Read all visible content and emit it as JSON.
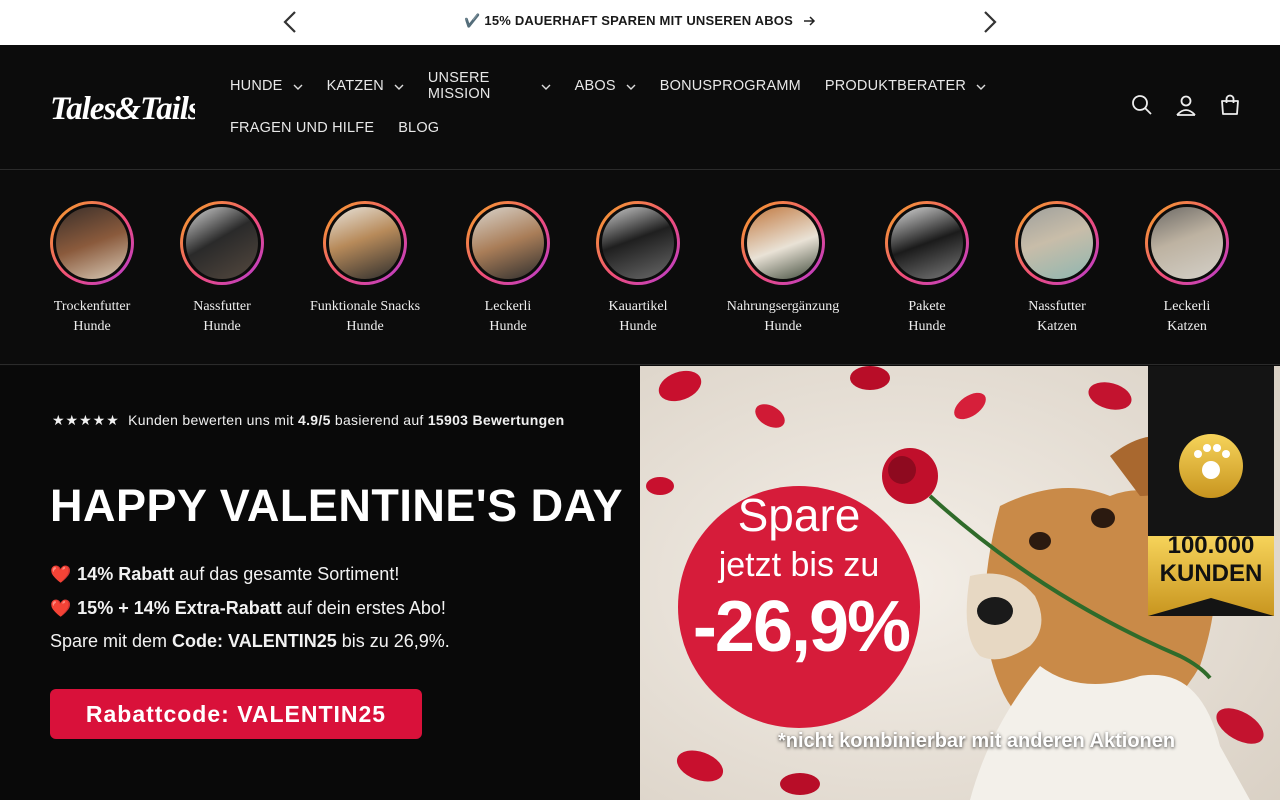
{
  "announcement": {
    "text": "✔️ 15% DAUERHAFT SPAREN MIT UNSEREN ABOS",
    "arrow": "→"
  },
  "header": {
    "logo_text": "Tales&Tails",
    "nav": {
      "row1": [
        {
          "label": "HUNDE",
          "dropdown": true
        },
        {
          "label": "KATZEN",
          "dropdown": true
        },
        {
          "label": "UNSERE MISSION",
          "dropdown": true
        },
        {
          "label": "ABOS",
          "dropdown": true
        },
        {
          "label": "BONUSPROGRAMM",
          "dropdown": false
        },
        {
          "label": "PRODUKTBERATER",
          "dropdown": true
        }
      ],
      "row2": [
        {
          "label": "FRAGEN UND HILFE",
          "dropdown": false
        },
        {
          "label": "BLOG",
          "dropdown": false
        }
      ]
    },
    "icons": [
      "search-icon",
      "account-icon",
      "cart-icon"
    ]
  },
  "categories": [
    {
      "line1": "Trockenfutter",
      "line2": "Hunde"
    },
    {
      "line1": "Nassfutter",
      "line2": "Hunde"
    },
    {
      "line1": "Funktionale Snacks",
      "line2": "Hunde"
    },
    {
      "line1": "Leckerli",
      "line2": "Hunde"
    },
    {
      "line1": "Kauartikel",
      "line2": "Hunde"
    },
    {
      "line1": "Nahrungsergänzung",
      "line2": "Hunde"
    },
    {
      "line1": "Pakete",
      "line2": "Hunde"
    },
    {
      "line1": "Nassfutter",
      "line2": "Katzen"
    },
    {
      "line1": "Leckerli",
      "line2": "Katzen"
    }
  ],
  "hero": {
    "rating": {
      "stars": "★★★★★",
      "prefix": "Kunden bewerten uns mit",
      "score": "4.9/5",
      "middle": "basierend auf",
      "count": "15903 Bewertungen"
    },
    "title": "HAPPY VALENTINE'S DAY",
    "line1": {
      "bold": "14% Rabatt",
      "rest": " auf das gesamte Sortiment!"
    },
    "line2": {
      "bold": "15% + 14% Extra-Rabatt",
      "rest": " auf dein erstes Abo!"
    },
    "line3": {
      "pre": "Spare mit dem ",
      "bold": "Code: VALENTIN25",
      "rest": " bis zu 26,9%."
    },
    "cta_label": "Rabattcode: VALENTIN25",
    "image": {
      "promo_line1": "Spare",
      "promo_line2": "jetzt bis zu",
      "promo_line3": "-26,9%",
      "badge_line1": "100.000",
      "badge_line2": "KUNDEN",
      "disclaimer": "*nicht kombinierbar mit anderen Aktionen"
    }
  },
  "colors": {
    "background": "#0b0b0b",
    "cta": "#d9113a",
    "promo_red": "#d61c3a",
    "badge_gold": "#e7b830",
    "heart": "#e5203a"
  }
}
